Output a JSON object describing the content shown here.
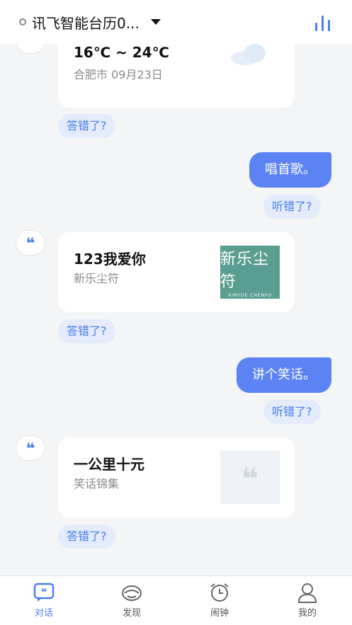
{
  "header": {
    "device_name": "讯飞智能台历0...",
    "dropdown_icon": "caret-down-icon",
    "voice_icon": "voice-wave-icon"
  },
  "chat": {
    "weather_card": {
      "temperature": "16℃ ~ 24℃",
      "location_date": "合肥市 09月23日",
      "icon": "cloud-icon"
    },
    "answer_wrong_1": "答错了?",
    "user_msg_1": "唱首歌。",
    "heard_wrong_1": "听错了?",
    "music_card": {
      "title": "123我爱你",
      "artist": "新乐尘符",
      "album_text": "新乐尘符",
      "album_subtext": "XINYUE CHENFU"
    },
    "answer_wrong_2": "答错了?",
    "user_msg_2": "讲个笑话。",
    "heard_wrong_2": "听错了?",
    "joke_card": {
      "title": "一公里十元",
      "subtitle": "笑话锦集",
      "icon": "quote-icon"
    },
    "answer_wrong_3": "答错了?",
    "assistant_avatar_icon": "quote-icon"
  },
  "tabbar": {
    "tabs": [
      {
        "label": "对话",
        "icon": "chat-quote-icon",
        "active": true
      },
      {
        "label": "发现",
        "icon": "discover-icon",
        "active": false
      },
      {
        "label": "闹钟",
        "icon": "alarm-clock-icon",
        "active": false
      },
      {
        "label": "我的",
        "icon": "profile-icon",
        "active": false
      }
    ]
  },
  "colors": {
    "accent": "#4a7cf0",
    "bubble": "#5b83f4",
    "chip_bg": "#e4ebfb",
    "background": "#f4f5f7"
  }
}
